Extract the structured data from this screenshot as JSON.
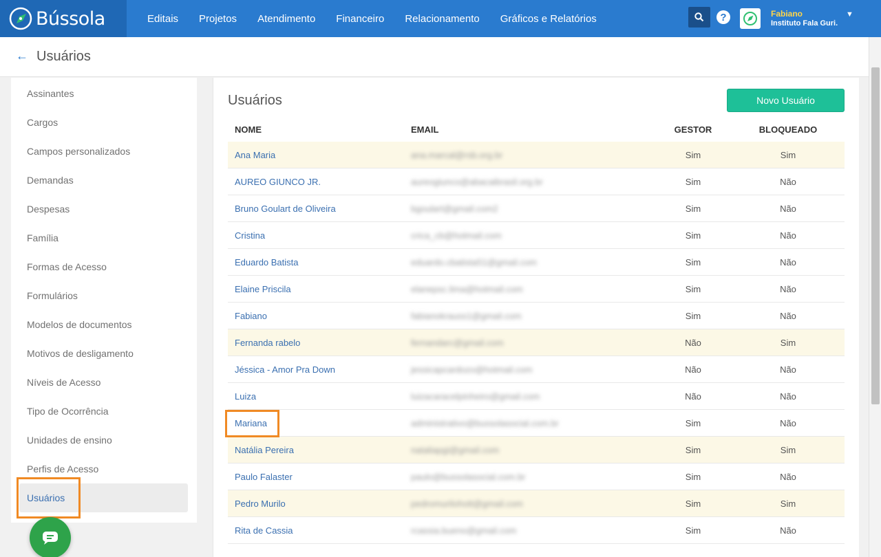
{
  "brand": {
    "name": "Bússola"
  },
  "nav": {
    "items": [
      "Editais",
      "Projetos",
      "Atendimento",
      "Financeiro",
      "Relacionamento",
      "Gráficos e Relatórios"
    ]
  },
  "user": {
    "name": "Fabiano",
    "org": "Instituto Fala Guri."
  },
  "page": {
    "title": "Usuários"
  },
  "sidebar": {
    "items": [
      {
        "label": "Assinantes"
      },
      {
        "label": "Cargos"
      },
      {
        "label": "Campos personalizados"
      },
      {
        "label": "Demandas"
      },
      {
        "label": "Despesas"
      },
      {
        "label": "Família"
      },
      {
        "label": "Formas de Acesso"
      },
      {
        "label": "Formulários"
      },
      {
        "label": "Modelos de documentos"
      },
      {
        "label": "Motivos de desligamento"
      },
      {
        "label": "Níveis de Acesso"
      },
      {
        "label": "Tipo de Ocorrência"
      },
      {
        "label": "Unidades de ensino"
      },
      {
        "label": "Perfis de Acesso"
      },
      {
        "label": "Usuários"
      }
    ],
    "active_index": 14
  },
  "main": {
    "title": "Usuários",
    "new_button": "Novo Usuário",
    "columns": [
      "NOME",
      "EMAIL",
      "GESTOR",
      "BLOQUEADO"
    ],
    "rows": [
      {
        "name": "Ana Maria",
        "email": "ana.marcal@rsb.org.br",
        "gestor": "Sim",
        "bloqueado": "Sim",
        "highlight": true
      },
      {
        "name": "AUREO GIUNCO JR.",
        "email": "aureogiunco@abacaibrasil.org.br",
        "gestor": "Sim",
        "bloqueado": "Não",
        "highlight": false
      },
      {
        "name": "Bruno Goulart de Oliveira",
        "email": "bgoulart@gmail.com2",
        "gestor": "Sim",
        "bloqueado": "Não",
        "highlight": false
      },
      {
        "name": "Cristina",
        "email": "crica_cb@hotmail.com",
        "gestor": "Sim",
        "bloqueado": "Não",
        "highlight": false
      },
      {
        "name": "Eduardo Batista",
        "email": "eduardo.cbatista51@gmail.com",
        "gestor": "Sim",
        "bloqueado": "Não",
        "highlight": false
      },
      {
        "name": "Elaine Priscila",
        "email": "elanepsc.lima@hotmail.com",
        "gestor": "Sim",
        "bloqueado": "Não",
        "highlight": false
      },
      {
        "name": "Fabiano",
        "email": "fabianokrauss1@gmail.com",
        "gestor": "Sim",
        "bloqueado": "Não",
        "highlight": false
      },
      {
        "name": "Fernanda rabelo",
        "email": "fernandarc@gmail.com",
        "gestor": "Não",
        "bloqueado": "Sim",
        "highlight": true
      },
      {
        "name": "Jéssica - Amor Pra Down",
        "email": "jessicapcardozo@hotmail.com",
        "gestor": "Não",
        "bloqueado": "Não",
        "highlight": false
      },
      {
        "name": "Luiza",
        "email": "luizacaracelpinheiro@gmail.com",
        "gestor": "Não",
        "bloqueado": "Não",
        "highlight": false
      },
      {
        "name": "Mariana",
        "email": "administrativo@bussolasocial.com.br",
        "gestor": "Sim",
        "bloqueado": "Não",
        "highlight": false
      },
      {
        "name": "Natália Pereira",
        "email": "nataliapgi@gmail.com",
        "gestor": "Sim",
        "bloqueado": "Sim",
        "highlight": true
      },
      {
        "name": "Paulo Falaster",
        "email": "paulo@bussolasocial.com.br",
        "gestor": "Sim",
        "bloqueado": "Não",
        "highlight": false
      },
      {
        "name": "Pedro Murilo",
        "email": "pedromurilohott@gmail.com",
        "gestor": "Sim",
        "bloqueado": "Sim",
        "highlight": true
      },
      {
        "name": "Rita de Cassia",
        "email": "rcassia.bueno@gmail.com",
        "gestor": "Sim",
        "bloqueado": "Não",
        "highlight": false
      }
    ]
  },
  "colors": {
    "topbar": "#2a7bcf",
    "brand_bg": "#1f68b5",
    "accent_button": "#1ec098",
    "link": "#3a6fb0",
    "row_highlight": "#fcf8e6",
    "annotation_box": "#f08a24",
    "user_name": "#ffd54a",
    "chat_bubble": "#2ea34a"
  },
  "icons": {
    "brand": "compass-icon",
    "search": "search-icon",
    "help": "help-icon",
    "avatar": "compass-avatar-icon",
    "user_menu": "chevron-down-icon",
    "back": "arrow-left-icon",
    "chat": "chat-icon"
  }
}
